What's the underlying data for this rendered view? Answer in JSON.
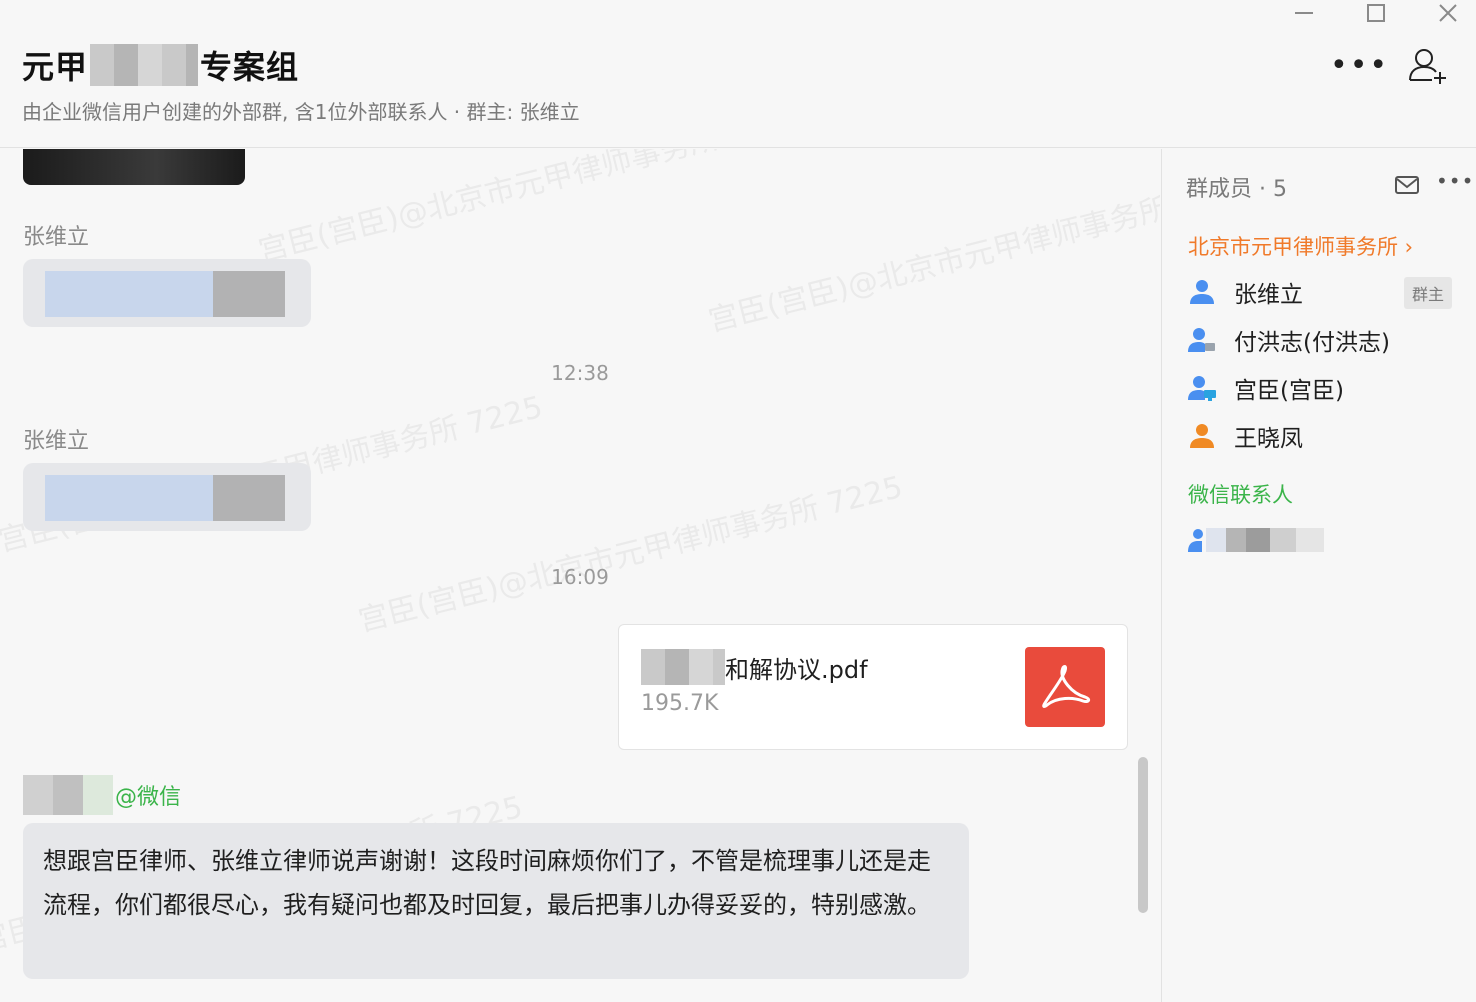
{
  "header": {
    "title_prefix": "元甲",
    "title_suffix": "专案组",
    "subtitle": "由企业微信用户创建的外部群, 含1位外部联系人 · 群主: 张维立",
    "more_label": "•••"
  },
  "chat": {
    "watermark": "宫臣(宫臣)@北京市元甲律师事务所 7225",
    "messages": [
      {
        "sender": "张维立"
      },
      {
        "time": "12:38"
      },
      {
        "sender": "张维立"
      },
      {
        "time": "16:09"
      }
    ],
    "file": {
      "name": "和解协议.pdf",
      "size": "195.7K"
    },
    "last_sender_tag": "@微信",
    "last_message": "想跟宫臣律师、张维立律师说声谢谢！这段时间麻烦你们了，不管是梳理事儿还是走流程，你们都很尽心，我有疑问也都及时回复，最后把事儿办得妥妥的，特别感激。"
  },
  "panel": {
    "title": "群成员 · 5",
    "more_label": "•••",
    "org": "北京市元甲律师事务所 ›",
    "members": [
      {
        "name": "张维立",
        "badge": "群主",
        "icon": "person-blue"
      },
      {
        "name": "付洪志(付洪志)",
        "icon": "person-blue-device"
      },
      {
        "name": "宫臣(宫臣)",
        "icon": "person-blue-computer"
      },
      {
        "name": "王晓凤",
        "icon": "person-orange"
      }
    ],
    "wechat_label": "微信联系人"
  },
  "colors": {
    "accent_orange": "#f07a2a",
    "wechat_green": "#3bb44a",
    "pdf_red": "#e94b3c",
    "bubble": "#e6e7ea"
  }
}
